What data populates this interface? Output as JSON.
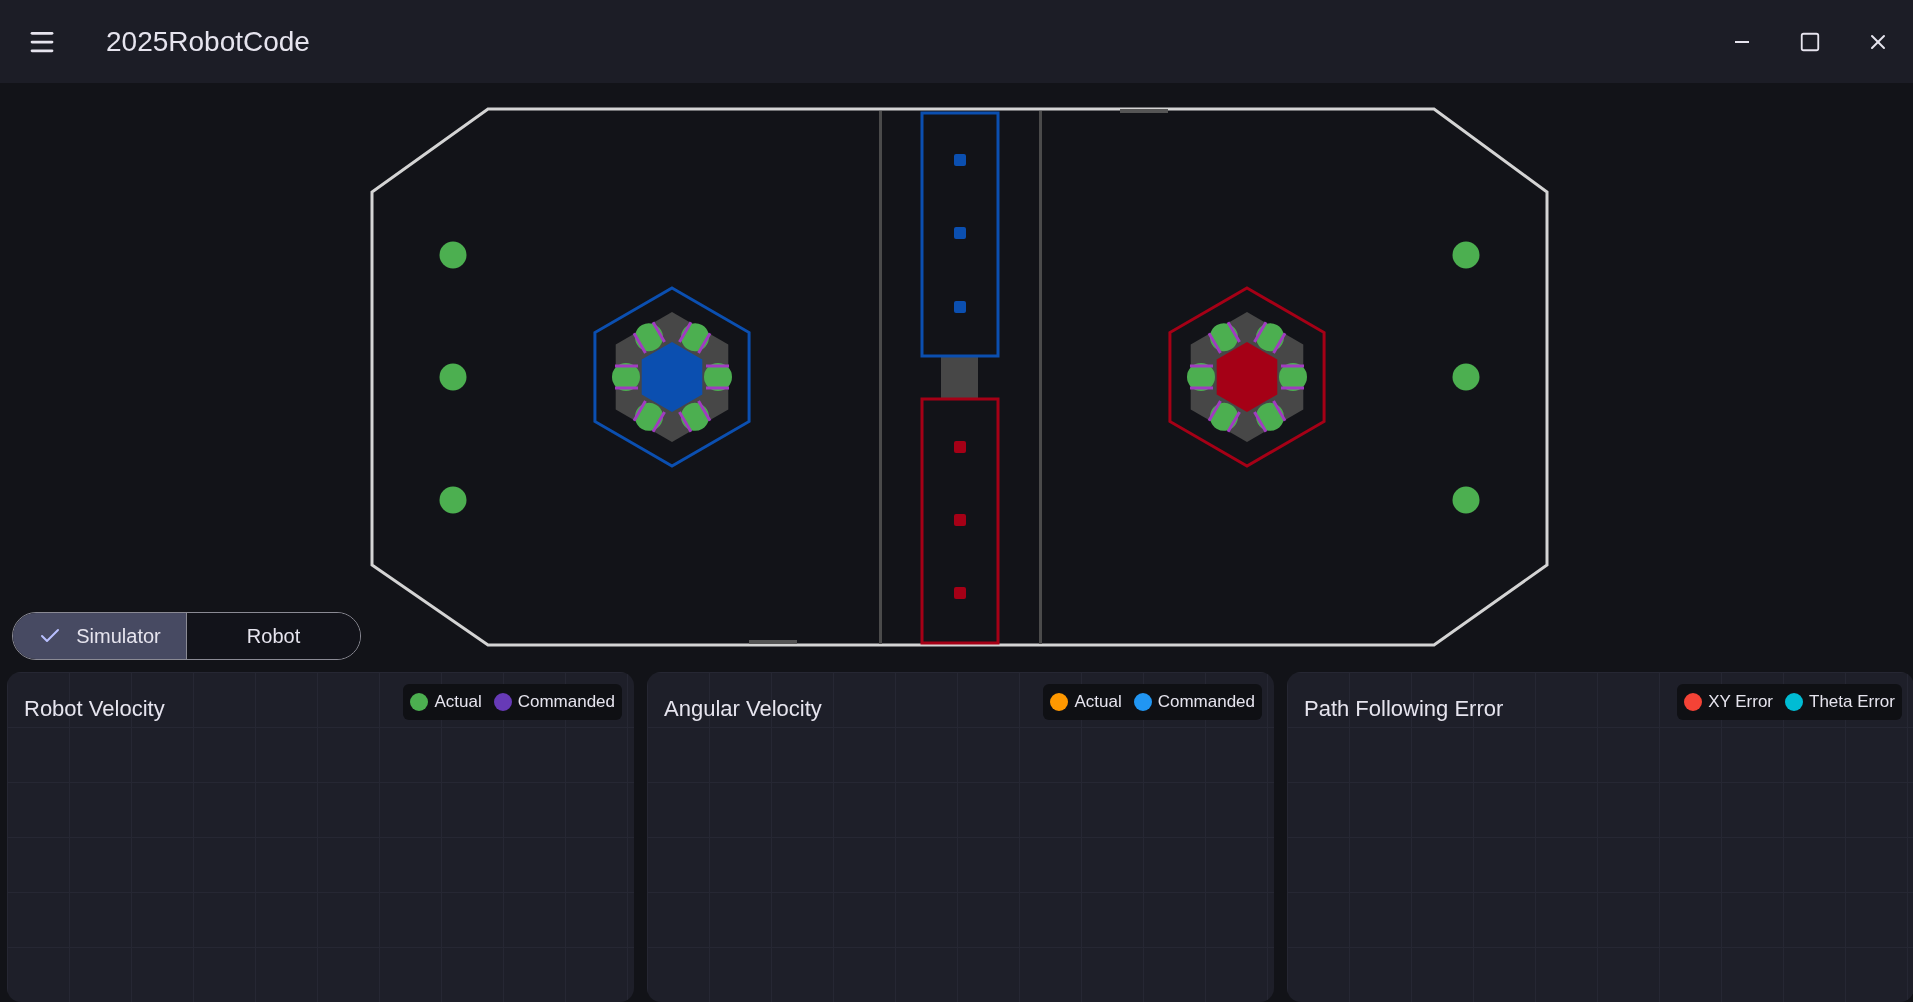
{
  "app": {
    "title": "2025RobotCode"
  },
  "mode_toggle": [
    {
      "label": "Simulator",
      "selected": true
    },
    {
      "label": "Robot",
      "selected": false
    }
  ],
  "charts": [
    {
      "title": "Robot Velocity",
      "legend": [
        {
          "label": "Actual",
          "color": "#4caf50"
        },
        {
          "label": "Commanded",
          "color": "#673ab7"
        }
      ]
    },
    {
      "title": "Angular Velocity",
      "legend": [
        {
          "label": "Actual",
          "color": "#ff9800"
        },
        {
          "label": "Commanded",
          "color": "#2196f3"
        }
      ]
    },
    {
      "title": "Path Following Error",
      "legend": [
        {
          "label": "XY Error",
          "color": "#f44336"
        },
        {
          "label": "Theta Error",
          "color": "#00bcd4"
        }
      ]
    }
  ]
}
